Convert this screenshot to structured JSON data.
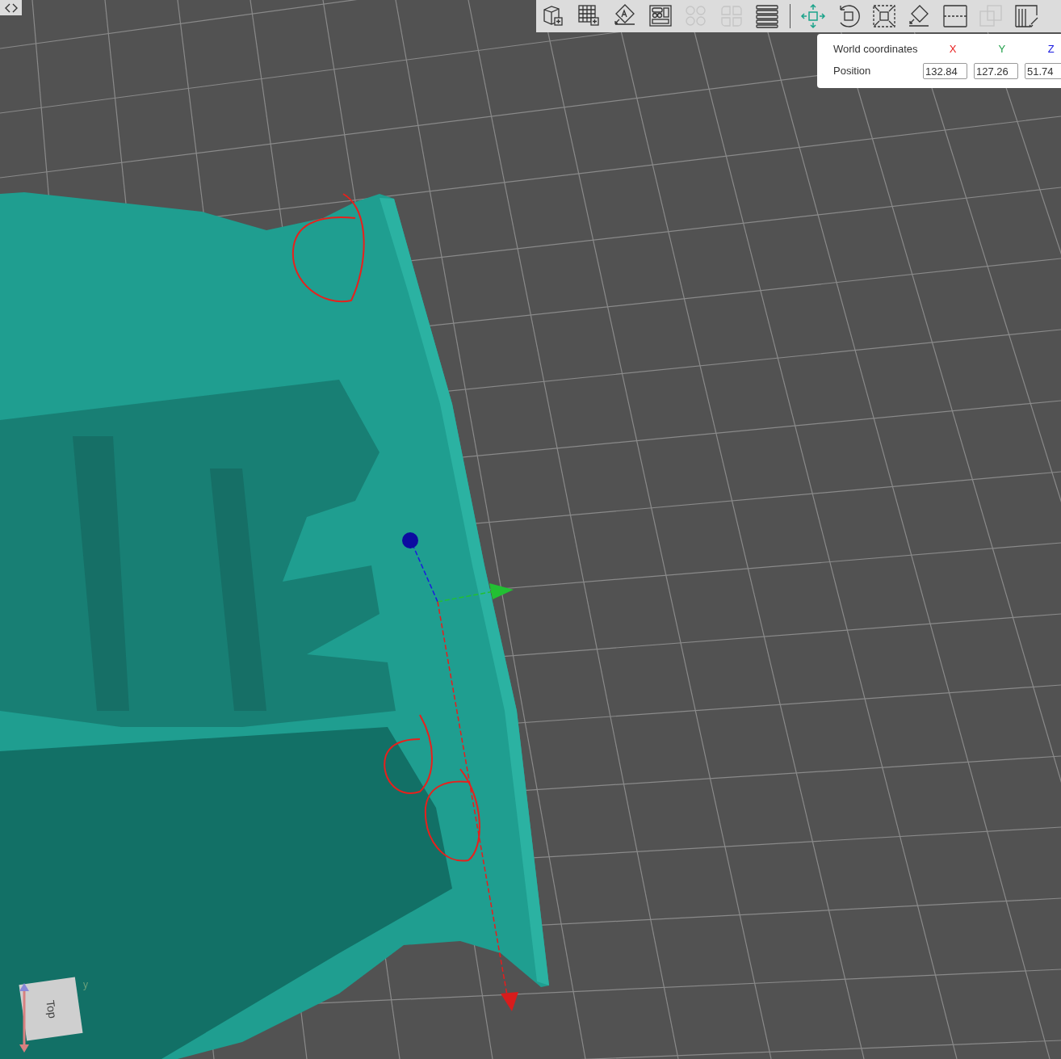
{
  "toolbar": {
    "tools": [
      {
        "kind": "tool",
        "disabled": false,
        "selected": false
      },
      {
        "kind": "tool",
        "disabled": false,
        "selected": false
      },
      {
        "kind": "tool",
        "disabled": false,
        "selected": false
      },
      {
        "kind": "tool",
        "disabled": false,
        "selected": false
      },
      {
        "kind": "tool",
        "disabled": true,
        "selected": false
      },
      {
        "kind": "tool",
        "disabled": true,
        "selected": false
      },
      {
        "kind": "tool",
        "disabled": false,
        "selected": false
      },
      {
        "kind": "separator"
      },
      {
        "kind": "tool",
        "disabled": false,
        "selected": true
      },
      {
        "kind": "tool",
        "disabled": false,
        "selected": false
      },
      {
        "kind": "tool",
        "disabled": false,
        "selected": false
      },
      {
        "kind": "tool",
        "disabled": false,
        "selected": false
      },
      {
        "kind": "tool",
        "disabled": false,
        "selected": false
      },
      {
        "kind": "tool",
        "disabled": true,
        "selected": false
      },
      {
        "kind": "tool",
        "disabled": false,
        "selected": false
      }
    ]
  },
  "coordinates_panel": {
    "title": "World coordinates",
    "axes": [
      {
        "label": "X",
        "color": "#e81c1c"
      },
      {
        "label": "Y",
        "color": "#22a04a"
      },
      {
        "label": "Z",
        "color": "#1a1ae0"
      }
    ],
    "row_label": "Position",
    "values": [
      "132.84",
      "127.26",
      "51.74"
    ]
  },
  "view_cube": {
    "face": "Top",
    "axis_label": "y"
  }
}
